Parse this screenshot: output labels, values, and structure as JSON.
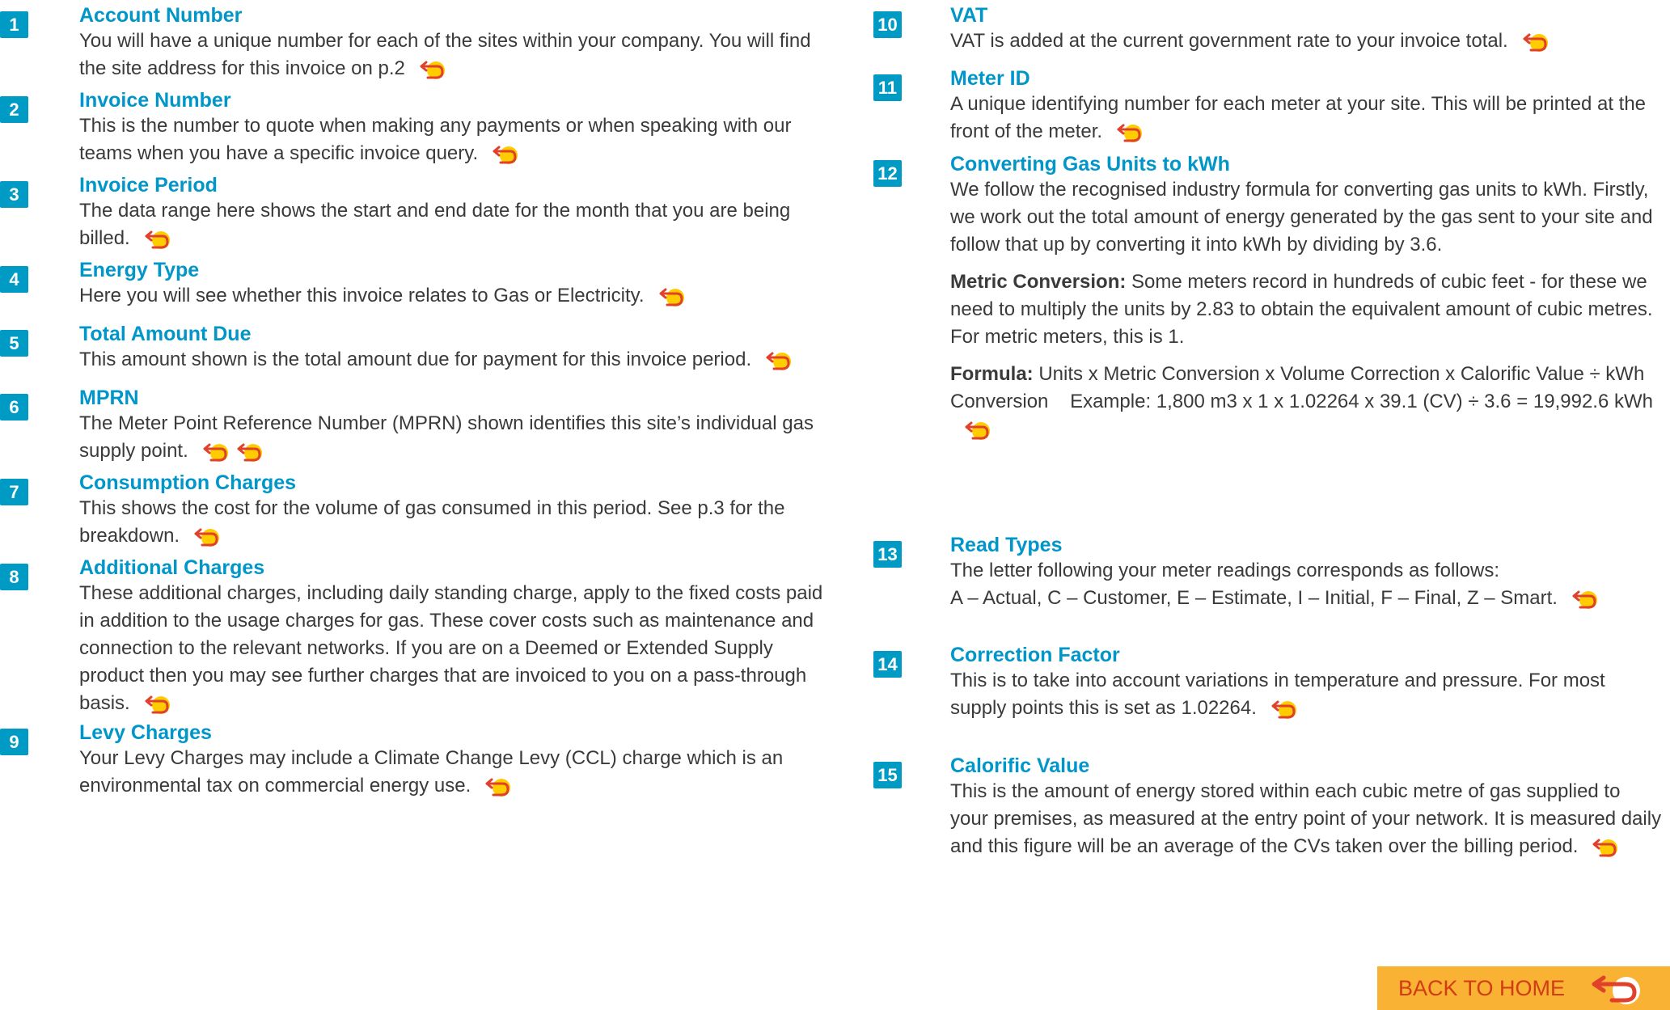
{
  "left_items": [
    {
      "number": "1",
      "title": "Account Number",
      "text": "You will have a unique number for each of the sites within your company. You will find the site address for this invoice on p.2"
    },
    {
      "number": "2",
      "title": "Invoice Number",
      "text": "This is the number to quote when making any payments or when speaking with our teams when you have a specific invoice query."
    },
    {
      "number": "3",
      "title": "Invoice Period",
      "text": "The data range here shows the start and end date for the month that you are being billed."
    },
    {
      "number": "4",
      "title": "Energy Type",
      "text": "Here you will see whether this invoice relates to Gas or Electricity."
    },
    {
      "number": "5",
      "title": "Total Amount Due",
      "text": "This amount shown is the total amount due for payment for this invoice period."
    },
    {
      "number": "6",
      "title": "MPRN",
      "text": "The Meter Point Reference Number (MPRN) shown identifies this site’s individual gas supply point."
    },
    {
      "number": "7",
      "title": "Consumption Charges",
      "text": "This shows the cost for the volume of gas consumed in this period. See p.3 for the breakdown."
    },
    {
      "number": "8",
      "title": "Additional Charges",
      "text": "These additional charges, including daily standing charge, apply to the fixed costs paid in addition to the usage charges for gas. These cover costs such as maintenance and connection to the relevant networks. If you are on a Deemed or Extended Supply product then you may see further charges that are invoiced to you on a pass-through basis."
    },
    {
      "number": "9",
      "title": "Levy Charges",
      "text": "Your Levy Charges may include a Climate Change Levy (CCL) charge which is an environmental tax on commercial energy use."
    }
  ],
  "right_items": [
    {
      "number": "10",
      "title": "VAT",
      "text": "VAT is added at the current government rate to your invoice total."
    },
    {
      "number": "11",
      "title": "Meter ID",
      "text": "A unique identifying number for each meter at your site. This will be printed at the front of the meter."
    },
    {
      "number": "12",
      "title": "Converting Gas Units to kWh",
      "text": "We follow the recognised industry formula for converting gas units to kWh. Firstly, we work out the total amount of energy generated by the gas sent to your site and follow that up by converting it into kWh by dividing by 3.6.",
      "metric_lead": "Metric Conversion:",
      "metric_text": " Some meters record in hundreds of cubic feet - for these we need to multiply the units by 2.83 to obtain the equivalent amount of cubic metres. For metric meters, this is 1.",
      "formula_lead": "Formula:",
      "formula_text": " Units x Metric Conversion x Volume Correction x Calorific Value ÷ kWh Conversion    Example: 1,800 m3 x 1 x 1.02264 x 39.1 (CV) ÷ 3.6 = 19,992.6 kWh"
    },
    {
      "number": "13",
      "title": "Read Types",
      "text": "The letter following your meter readings corresponds as follows:",
      "text2": "A – Actual, C – Customer, E – Estimate, I – Initial, F – Final, Z – Smart."
    },
    {
      "number": "14",
      "title": "Correction Factor",
      "text": "This is to take into account variations in temperature and pressure. For most supply points this is set as 1.02264."
    },
    {
      "number": "15",
      "title": "Calorific Value",
      "text": "This is the amount of energy stored within each cubic metre of gas supplied to your premises, as measured at the entry point of your network. It is measured daily and this figure will be an average of the CVs taken over the billing period."
    }
  ],
  "back_home_label": "BACK TO HOME",
  "colors": {
    "accent": "#009bc4",
    "title": "#0096c9",
    "button_bg": "#f9b233",
    "button_text": "#d23c14",
    "icon": "#f7c600"
  },
  "icons": {
    "back": "back-arrow-icon"
  }
}
